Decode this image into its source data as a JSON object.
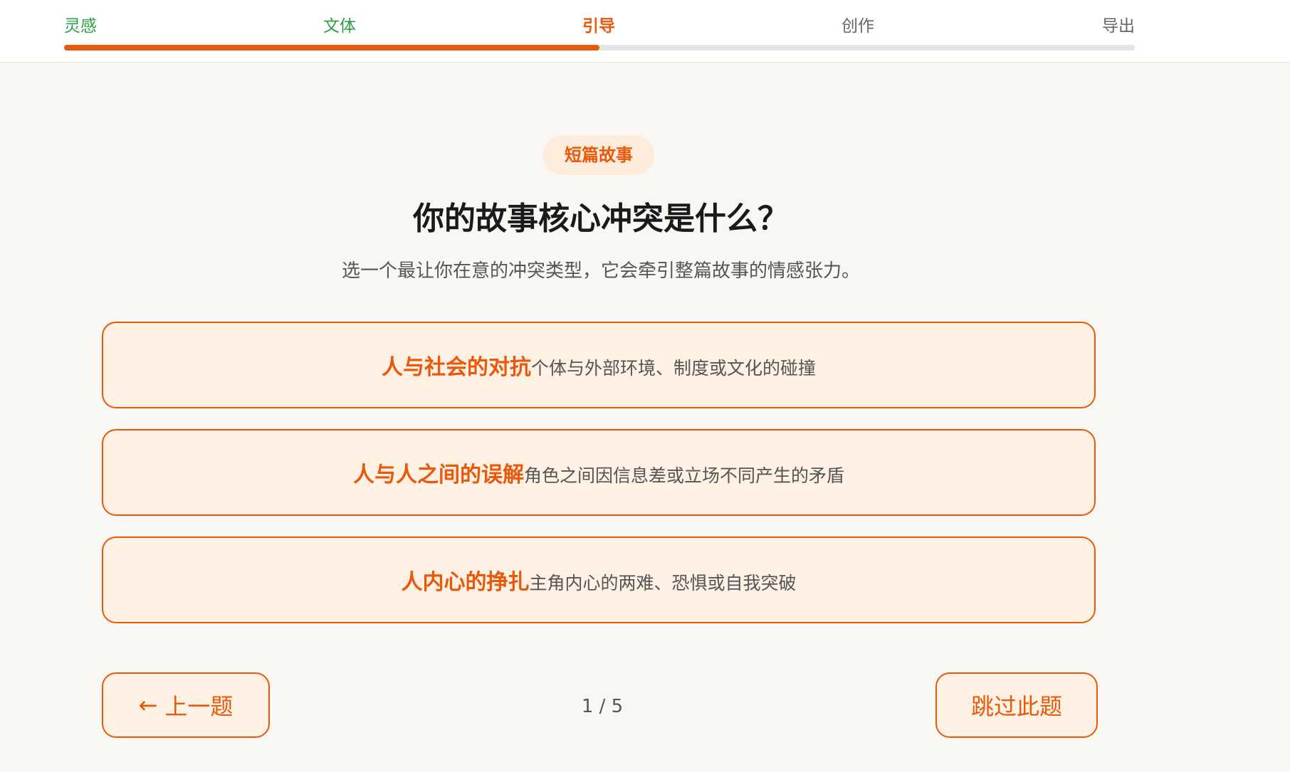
{
  "steps": {
    "items": [
      {
        "label": "灵感",
        "state": "done"
      },
      {
        "label": "文体",
        "state": "done"
      },
      {
        "label": "引导",
        "state": "current"
      },
      {
        "label": "创作",
        "state": "todo"
      },
      {
        "label": "导出",
        "state": "todo"
      }
    ],
    "progress_percent": 50
  },
  "badge": "短篇故事",
  "question": {
    "title": "你的故事核心冲突是什么？",
    "subtitle": "选一个最让你在意的冲突类型，它会牵引整篇故事的情感张力。"
  },
  "options": [
    {
      "title": "人与社会的对抗",
      "desc": "个体与外部环境、制度或文化的碰撞"
    },
    {
      "title": "人与人之间的误解",
      "desc": "角色之间因信息差或立场不同产生的矛盾"
    },
    {
      "title": "人内心的挣扎",
      "desc": "主角内心的两难、恐惧或自我突破"
    }
  ],
  "nav": {
    "prev_arrow": "←",
    "prev_label": "上一题",
    "counter": "1 / 5",
    "skip_label": "跳过此题"
  },
  "colors": {
    "accent": "#e8590c",
    "done": "#2f9e44",
    "option_bg": "#fef1e4",
    "page_bg": "#f9f7f3"
  }
}
